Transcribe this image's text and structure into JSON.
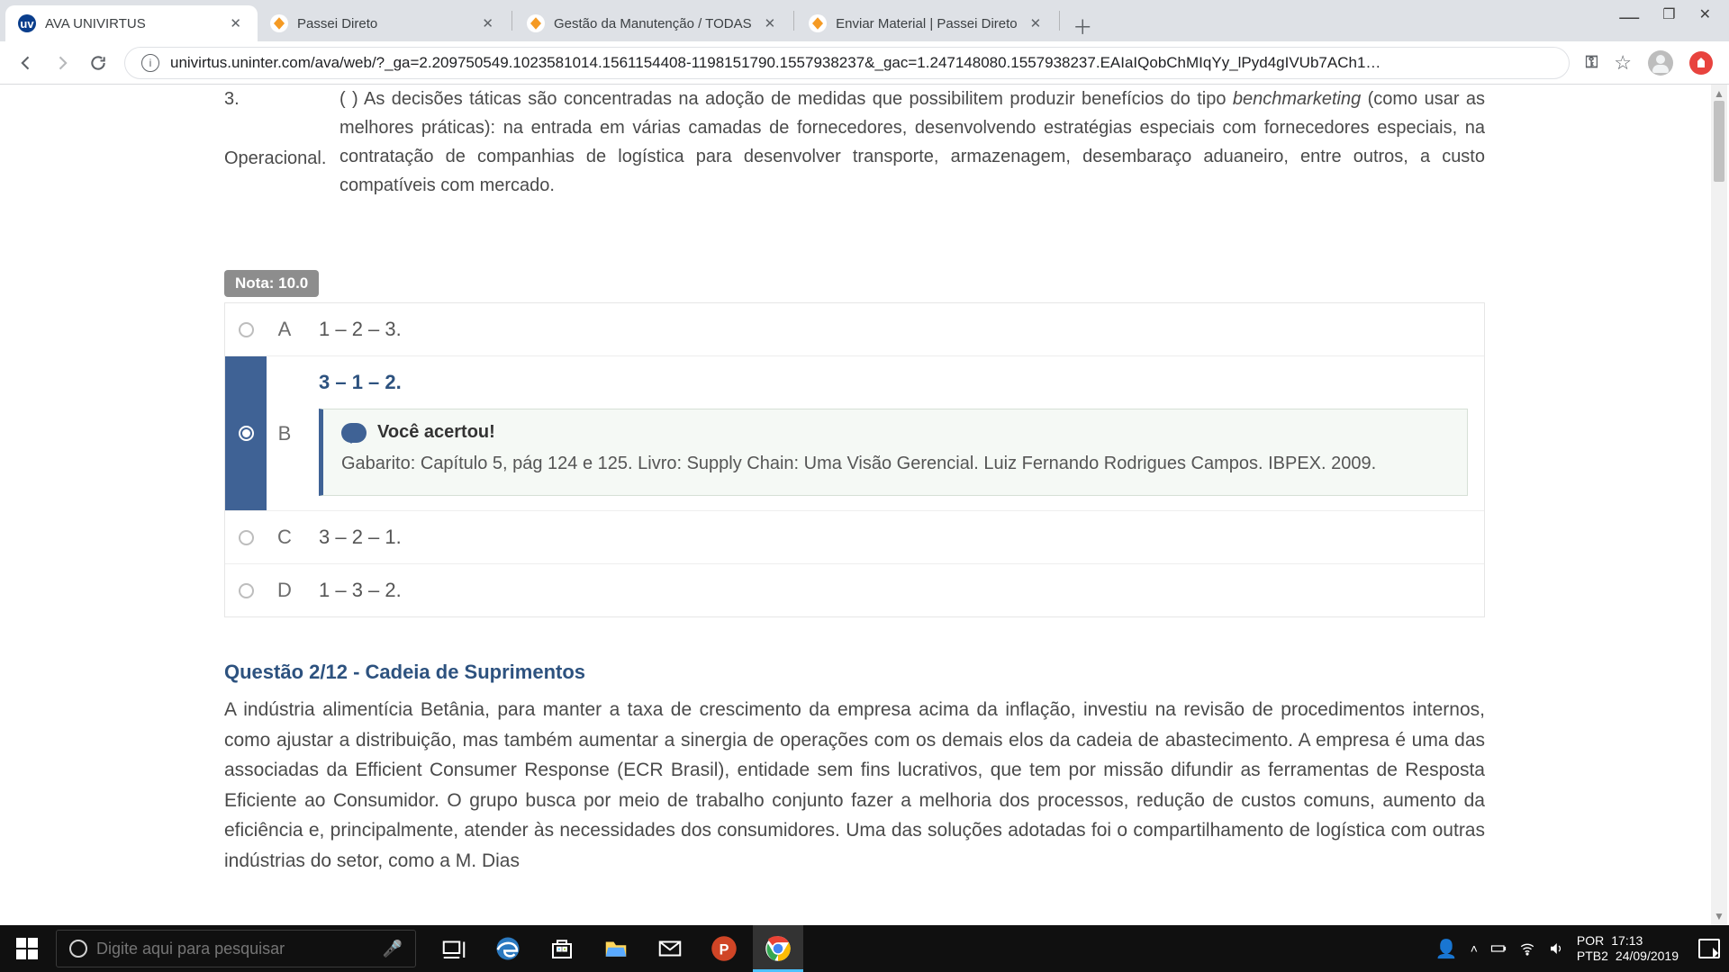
{
  "browser": {
    "tabs": [
      {
        "title": "AVA UNIVIRTUS",
        "favicon": "uv",
        "active": true
      },
      {
        "title": "Passei Direto",
        "favicon": "pd",
        "active": false
      },
      {
        "title": "Gestão da Manutenção / TODAS",
        "favicon": "pd",
        "active": false
      },
      {
        "title": "Enviar Material | Passei Direto",
        "favicon": "pd",
        "active": false
      }
    ],
    "url": "univirtus.uninter.com/ava/web/?_ga=2.209750549.1023581014.1561154408-1198151790.1557938237&_gac=1.247148080.1557938237.EAIaIQobChMIqYy_lPyd4gIVUb7ACh1…"
  },
  "question1": {
    "number": "3.",
    "label": "Operacional.",
    "text_lead": "(   ) As decisões táticas são concentradas na adoção de medidas que possibilitem produzir benefícios do tipo ",
    "text_em": "benchmarketing",
    "text_rest": " (como usar as melhores práticas): na entrada em várias camadas de fornecedores, desenvolvendo estratégias especiais com fornecedores especiais, na contratação de companhias de logística para desenvolver transporte, armazenagem, desembaraço aduaneiro, entre outros, a custo compatíveis com mercado.",
    "score": "Nota: 10.0",
    "options": [
      {
        "letter": "A",
        "value": "1 – 2 – 3."
      },
      {
        "letter": "B",
        "value": "3 – 1 – 2.",
        "correct": true
      },
      {
        "letter": "C",
        "value": "3 – 2 – 1."
      },
      {
        "letter": "D",
        "value": "1 – 3 – 2."
      }
    ],
    "feedback_title": "Você acertou!",
    "feedback_text": "Gabarito: Capítulo 5, pág 124 e 125. Livro: Supply Chain: Uma Visão Gerencial. Luiz Fernando Rodrigues Campos. IBPEX. 2009."
  },
  "question2": {
    "title": "Questão 2/12 - Cadeia de Suprimentos",
    "text": "A indústria alimentícia Betânia, para manter a taxa de crescimento da empresa acima da inflação, investiu na revisão de procedimentos internos, como ajustar a distribuição, mas também aumentar a sinergia de operações com os demais elos da cadeia de abastecimento. A empresa é uma das associadas da Efficient Consumer Response (ECR Brasil), entidade sem fins lucrativos, que tem por missão difundir as ferramentas de Resposta Eficiente ao Consumidor. O grupo busca por meio de trabalho conjunto fazer a melhoria dos processos, redução de custos comuns, aumento da eficiência e, principalmente, atender às necessidades dos consumidores. Uma das soluções adotadas foi o compartilhamento de logística com outras indústrias do setor, como a M. Dias"
  },
  "taskbar": {
    "search_placeholder": "Digite aqui para pesquisar",
    "lang1": "POR",
    "lang2": "PTB2",
    "time": "17:13",
    "date": "24/09/2019"
  }
}
